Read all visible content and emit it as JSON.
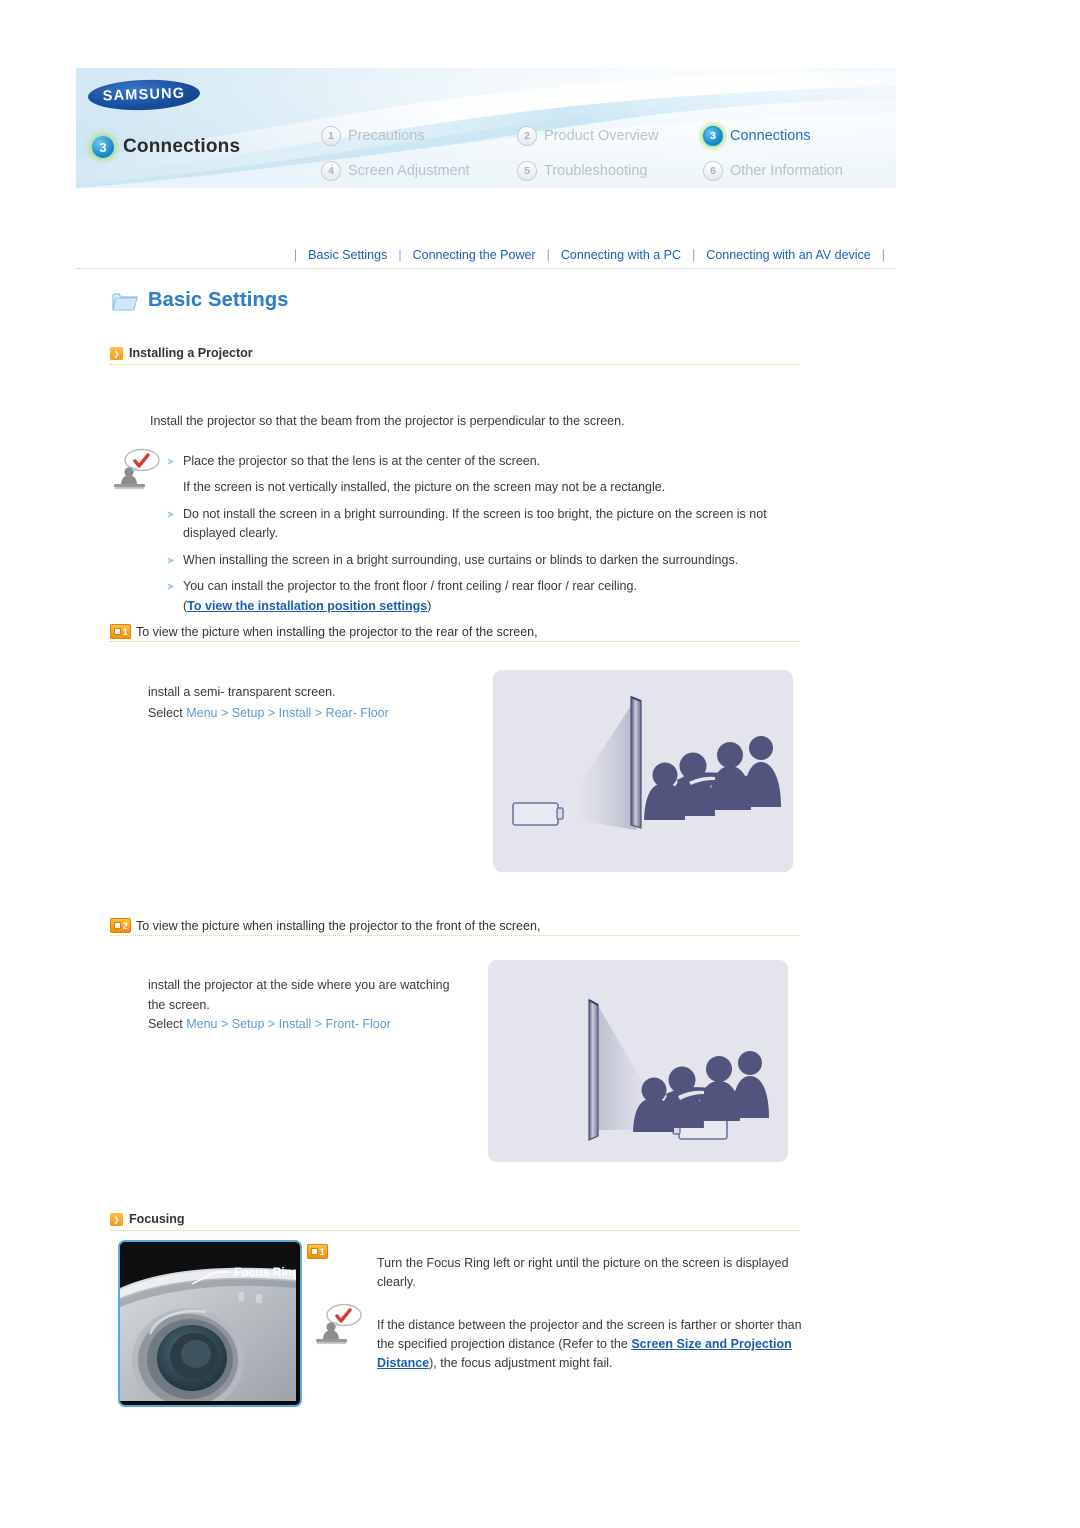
{
  "banner": {
    "brand": "SAMSUNG",
    "chapter_number": "3",
    "chapter_title": "Connections",
    "menu": [
      {
        "num": "1",
        "label": "Precautions",
        "active": false
      },
      {
        "num": "2",
        "label": "Product Overview",
        "active": false
      },
      {
        "num": "3",
        "label": "Connections",
        "active": true
      },
      {
        "num": "4",
        "label": "Screen Adjustment",
        "active": false
      },
      {
        "num": "5",
        "label": "Troubleshooting",
        "active": false
      },
      {
        "num": "6",
        "label": "Other Information",
        "active": false
      }
    ]
  },
  "subnav": {
    "separator": "|",
    "links": [
      "Basic Settings",
      "Connecting the Power",
      "Connecting with a PC",
      "Connecting with an AV device"
    ]
  },
  "page_title": "Basic Settings",
  "sections": {
    "installing": {
      "heading": "Installing a Projector",
      "intro": "Install the projector so that the beam from the projector is perpendicular to the screen.",
      "bullets": [
        "Place the projector so that the lens is at the center of the screen.",
        "If the screen is not vertically installed, the picture on the screen may not be a rectangle.",
        "Do not install the screen in a bright surrounding. If the screen is too bright, the picture on the screen is not displayed clearly.",
        "When installing the screen in a bright surrounding, use curtains or blinds to darken the surroundings.",
        "You can install the projector to the front floor / front ceiling / rear floor / rear ceiling."
      ],
      "bullet_link_prefix": "(",
      "bullet_link": "To view the installation position settings",
      "bullet_link_suffix": ")"
    },
    "step1": {
      "badge": "1",
      "heading": "To view the picture when installing the projector to the rear of the screen,",
      "line1": "install a semi- transparent screen.",
      "select_label": "Select",
      "select_path": "Menu > Setup > Install > Rear- Floor"
    },
    "step2": {
      "badge": "2",
      "heading": "To view the picture when installing the projector to the front of the screen,",
      "line1": "install the projector at the side where you are watching",
      "line2": "the screen.",
      "select_label": "Select",
      "select_path": "Menu > Setup > Install > Front- Floor"
    },
    "focusing": {
      "heading": "Focusing",
      "badge": "1",
      "photo_label": "Focus Ring",
      "text": "Turn the Focus Ring left or right until the picture on the screen is displayed clearly.",
      "note_part1": "If the distance between the projector and the screen is farther or shorter than the specified projection distance (Refer to the ",
      "note_link": "Screen Size and Projection Distance",
      "note_part2": "), the focus adjustment might fail."
    }
  },
  "colors": {
    "link_blue": "#1a5fb4",
    "menu_blue": "#5b9bd5",
    "title_blue": "#2d7ecb",
    "badge_orange": "#f59a12",
    "rule_green": "#cfe08a",
    "illus_bg": "#e3e4ec",
    "silhouette": "#51547c"
  },
  "icons": {
    "folder": "folder-icon",
    "tip": "tip-person-icon",
    "bullet": "chevron-bullet-icon"
  }
}
